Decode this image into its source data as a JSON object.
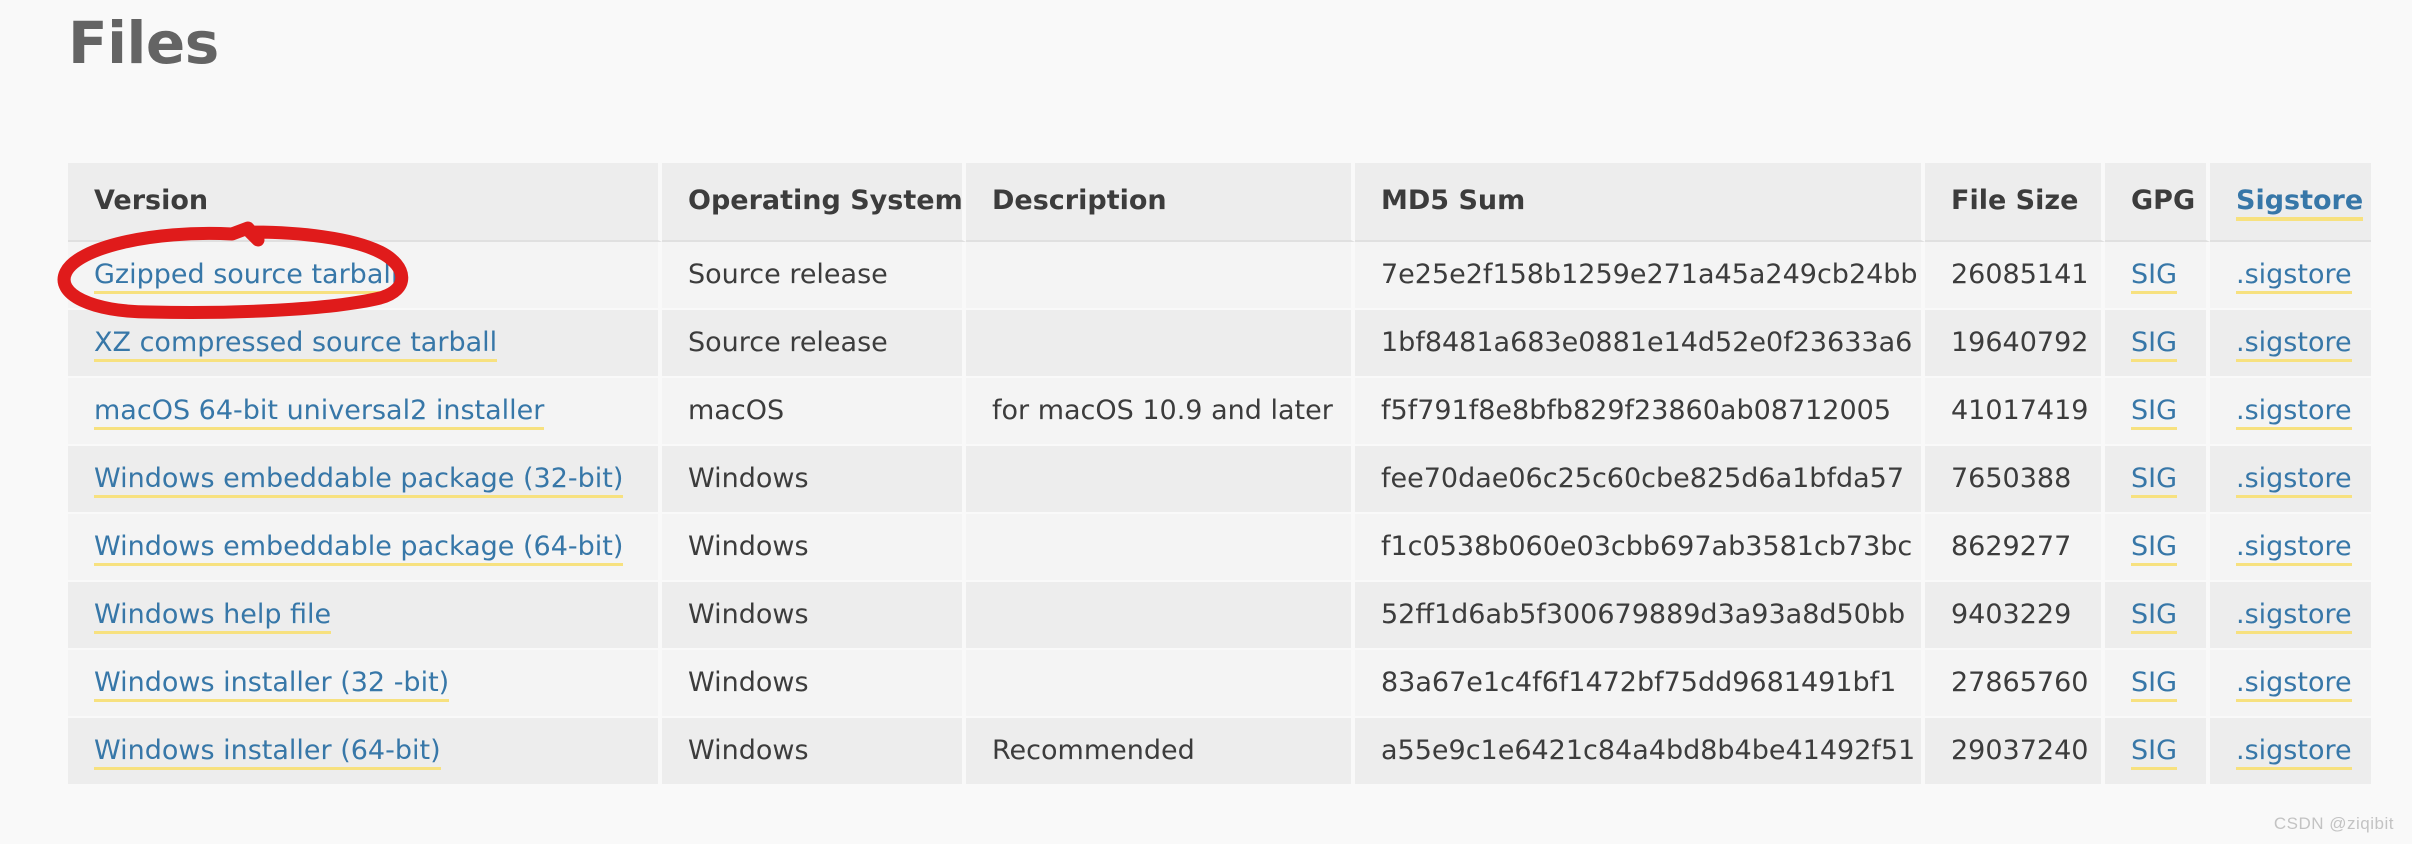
{
  "page": {
    "title": "Files",
    "watermark": "CSDN @ziqibit",
    "background_color": "#f9f9f9",
    "link_color": "#3777a8",
    "link_underline_color": "#f7e17f",
    "annotation_color": "#e01b1b"
  },
  "table": {
    "name": "files-table",
    "columns": [
      {
        "key": "version",
        "label": "Version",
        "is_link": false
      },
      {
        "key": "os",
        "label": "Operating System",
        "is_link": false
      },
      {
        "key": "description",
        "label": "Description",
        "is_link": false
      },
      {
        "key": "md5",
        "label": "MD5 Sum",
        "is_link": false
      },
      {
        "key": "size",
        "label": "File Size",
        "is_link": false
      },
      {
        "key": "gpg",
        "label": "GPG",
        "is_link": false
      },
      {
        "key": "sigstore",
        "label": "Sigstore",
        "is_link": true
      }
    ],
    "rows": [
      {
        "version": "Gzipped source tarball",
        "os": "Source release",
        "description": "",
        "md5": "7e25e2f158b1259e271a45a249cb24bb",
        "size": "26085141",
        "gpg": "SIG",
        "sigstore": ".sigstore",
        "annotated": true
      },
      {
        "version": "XZ compressed source tarball",
        "os": "Source release",
        "description": "",
        "md5": "1bf8481a683e0881e14d52e0f23633a6",
        "size": "19640792",
        "gpg": "SIG",
        "sigstore": ".sigstore",
        "annotated": false
      },
      {
        "version": "macOS 64-bit universal2 installer",
        "os": "macOS",
        "description": "for macOS 10.9 and later",
        "md5": "f5f791f8e8bfb829f23860ab08712005",
        "size": "41017419",
        "gpg": "SIG",
        "sigstore": ".sigstore",
        "annotated": false
      },
      {
        "version": "Windows embeddable package (32-bit)",
        "os": "Windows",
        "description": "",
        "md5": "fee70dae06c25c60cbe825d6a1bfda57",
        "size": "7650388",
        "gpg": "SIG",
        "sigstore": ".sigstore",
        "annotated": false
      },
      {
        "version": "Windows embeddable package (64-bit)",
        "os": "Windows",
        "description": "",
        "md5": "f1c0538b060e03cbb697ab3581cb73bc",
        "size": "8629277",
        "gpg": "SIG",
        "sigstore": ".sigstore",
        "annotated": false
      },
      {
        "version": "Windows help file",
        "os": "Windows",
        "description": "",
        "md5": "52ff1d6ab5f300679889d3a93a8d50bb",
        "size": "9403229",
        "gpg": "SIG",
        "sigstore": ".sigstore",
        "annotated": false
      },
      {
        "version": "Windows installer (32 -bit)",
        "os": "Windows",
        "description": "",
        "md5": "83a67e1c4f6f1472bf75dd9681491bf1",
        "size": "27865760",
        "gpg": "SIG",
        "sigstore": ".sigstore",
        "annotated": false
      },
      {
        "version": "Windows installer (64-bit)",
        "os": "Windows",
        "description": "Recommended",
        "md5": "a55e9c1e6421c84a4bd8b4be41492f51",
        "size": "29037240",
        "gpg": "SIG",
        "sigstore": ".sigstore",
        "annotated": false
      }
    ]
  },
  "annotation": {
    "type": "hand-drawn-ellipse",
    "target": "Gzipped source tarball",
    "color": "#e01b1b"
  }
}
